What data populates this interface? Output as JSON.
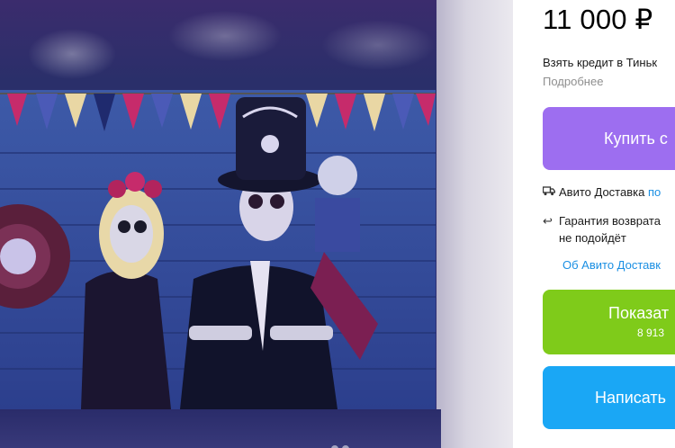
{
  "listing": {
    "price": "11 000 ₽",
    "credit_text": "Взять кредит в Тиньк",
    "more_link": "Подробнее",
    "buy_button": "Купить с",
    "delivery": {
      "label": "Авито Доставка",
      "link": "по"
    },
    "guarantee": {
      "line1": "Гарантия возврата",
      "line2": "не подойдёт"
    },
    "about_delivery_link": "Об Авито Доставк",
    "show_phone_button": "Показат",
    "phone_partial": "8 913 ",
    "write_button": "Написать"
  },
  "icons": {
    "delivery": "truck-icon",
    "guarantee": "return-arrow-icon"
  },
  "colors": {
    "buy": "#9d6ef0",
    "show_phone": "#7fcb1a",
    "write": "#1aa7f5",
    "link": "#1a8fe3"
  }
}
